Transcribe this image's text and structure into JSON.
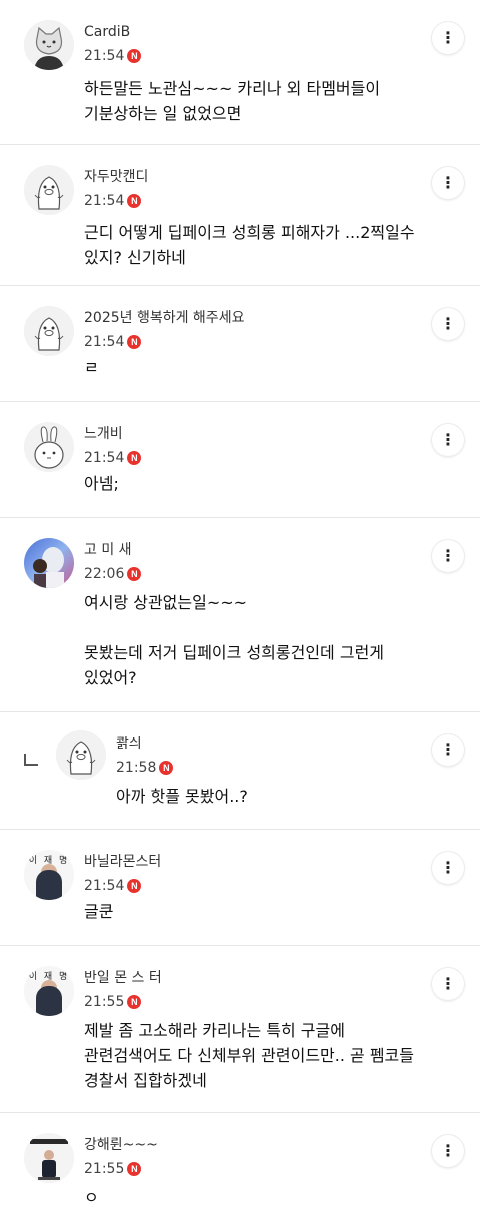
{
  "comments": [
    {
      "nick": "CardiB",
      "time": "21:54",
      "badge": "N",
      "text": "하든말든 노관심~~~ 카리나 외 타멤버들이\n기분상하는 일 없었으면"
    },
    {
      "nick": "자두맛캔디",
      "time": "21:54",
      "badge": "N",
      "text": "근디 어떻게 딥페이크 성희롱 피해자가 ...2찍일수\n있지? 신기하네"
    },
    {
      "nick": "2025년 행복하게 해주세요",
      "time": "21:54",
      "badge": "N",
      "text": "ㄹ"
    },
    {
      "nick": "느개비",
      "time": "21:54",
      "badge": "N",
      "text": "아넴;"
    },
    {
      "nick": "고 미 새",
      "time": "22:06",
      "badge": "N",
      "text": "여시랑 상관없는일~~~\n\n못봤는데 저거 딥페이크 성희롱건인데 그런게\n있었어?"
    },
    {
      "nick": "콹싀",
      "time": "21:58",
      "badge": "N",
      "text": "아까 핫플 못봤어..?"
    },
    {
      "nick": "바닐라몬스터",
      "time": "21:54",
      "badge": "N",
      "text": "글쿤",
      "card": "이 재 명"
    },
    {
      "nick": "반일 몬 스 터",
      "time": "21:55",
      "badge": "N",
      "text": "제발 좀 고소해라 카리나는 특히 구글에\n관련검색어도 다 신체부위 관련이드만.. 곧 펨코들\n경찰서 집합하겠네",
      "card": "이 재 명"
    },
    {
      "nick": "강해륀~~~",
      "time": "21:55",
      "badge": "N",
      "text": "ㅇ"
    }
  ],
  "more_glyph": "⋮"
}
